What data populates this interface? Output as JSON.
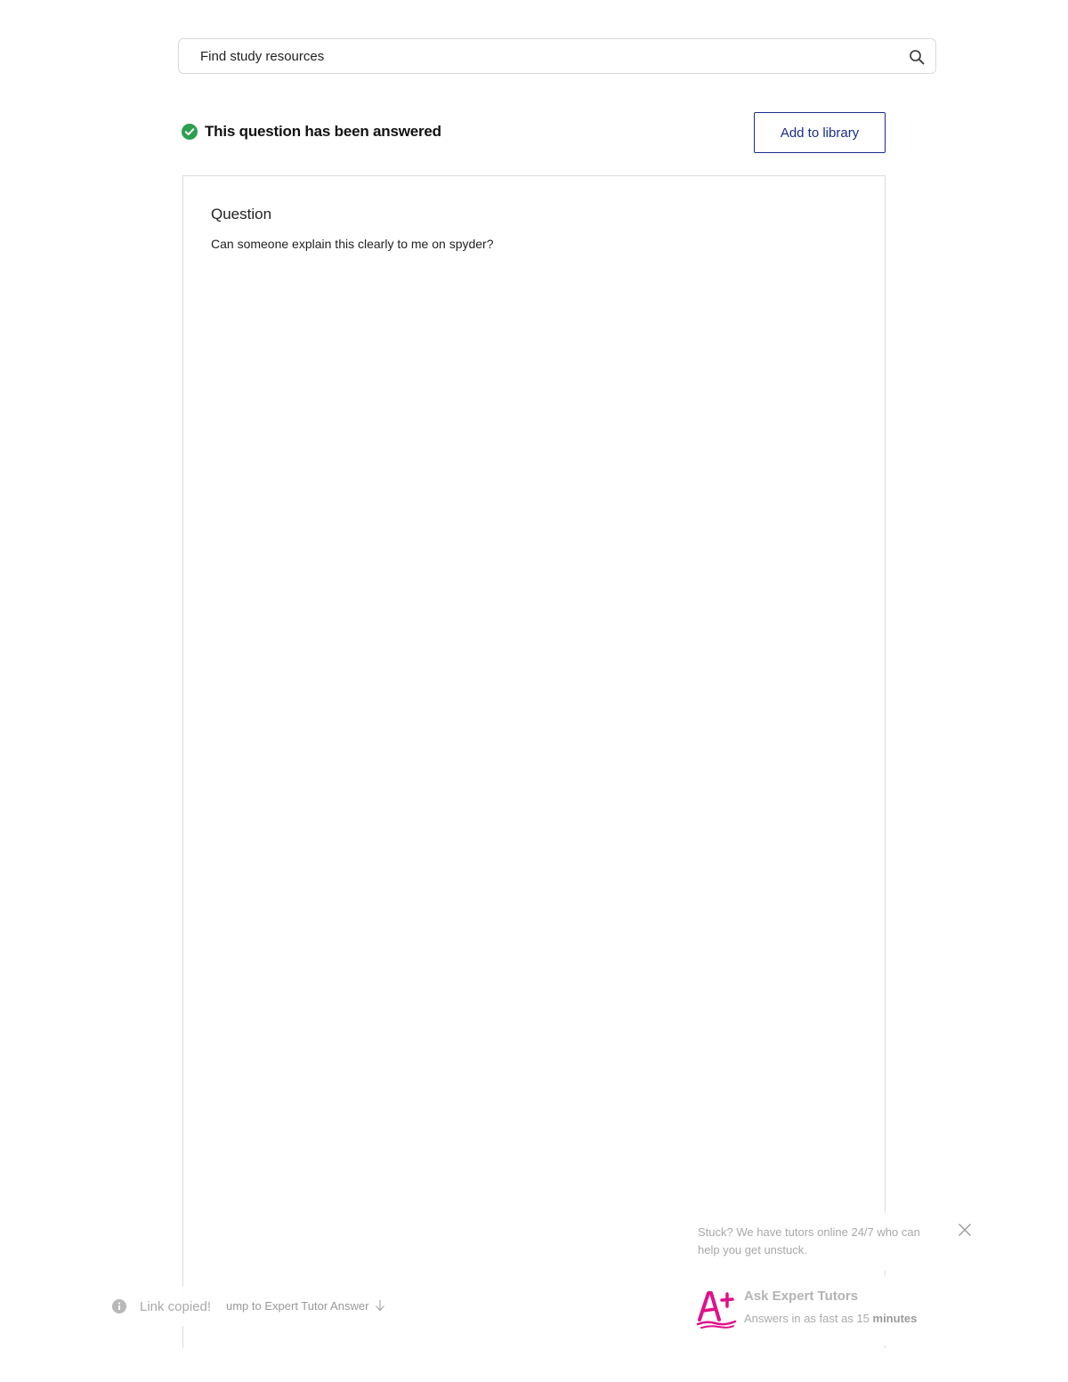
{
  "search": {
    "placeholder": "Find study resources",
    "icon": "search-icon"
  },
  "status": {
    "text": "This question has been answered",
    "icon": "check-circle-icon",
    "color": "#2e9e4f"
  },
  "actions": {
    "add_to_library": "Add to library",
    "accent_color": "#1a2c8c"
  },
  "question": {
    "heading": "Question",
    "body": "Can someone explain this clearly to me on spyder?"
  },
  "toast": {
    "text": "Link copied!",
    "icon": "info-icon"
  },
  "jump": {
    "label": "ump to Expert Tutor Answer",
    "icon": "arrow-down-icon"
  },
  "tutor": {
    "promo": "Stuck? We have tutors online 24/7 who can help you get unstuck.",
    "title": "Ask Expert Tutors",
    "subtitle_prefix": "Answers in as fast as 15 ",
    "subtitle_bold": "minutes",
    "logo_color": "#e0108a",
    "close_icon": "close-icon",
    "logo_icon": "a-plus-logo-icon"
  }
}
